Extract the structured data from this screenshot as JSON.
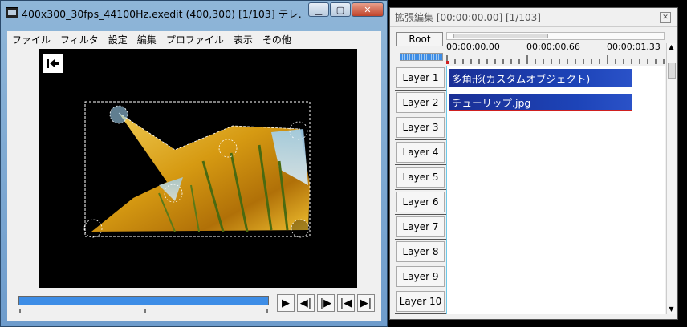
{
  "main_window": {
    "title": "400x300_30fps_44100Hz.exedit (400,300)  [1/103]  テレ...",
    "menu": [
      "ファイル",
      "フィルタ",
      "設定",
      "編集",
      "プロファイル",
      "表示",
      "その他"
    ],
    "playback_buttons": [
      "▶",
      "◀|",
      "|▶",
      "|◀",
      "▶|"
    ]
  },
  "timeline_window": {
    "title": "拡張編集 [00:00:00.00] [1/103]",
    "root_label": "Root",
    "ruler_labels": [
      "00:00:00.00",
      "00:00:00.66",
      "00:00:01.33"
    ],
    "layers": [
      {
        "label": "Layer  1",
        "clip": "多角形(カスタムオブジェクト)"
      },
      {
        "label": "Layer  2",
        "clip": "チューリップ.jpg"
      },
      {
        "label": "Layer  3",
        "clip": ""
      },
      {
        "label": "Layer  4",
        "clip": ""
      },
      {
        "label": "Layer  5",
        "clip": ""
      },
      {
        "label": "Layer  6",
        "clip": ""
      },
      {
        "label": "Layer  7",
        "clip": ""
      },
      {
        "label": "Layer  8",
        "clip": ""
      },
      {
        "label": "Layer  9",
        "clip": ""
      },
      {
        "label": "Layer 10",
        "clip": ""
      }
    ]
  },
  "icons": [
    "film-icon",
    "minimize-icon",
    "maximize-icon",
    "close-icon",
    "back-to-start-icon"
  ],
  "colors": {
    "title_gradient": "#7fa9d3",
    "clip_blue": "#1d44b8",
    "seek_blue": "#3d8de6"
  }
}
